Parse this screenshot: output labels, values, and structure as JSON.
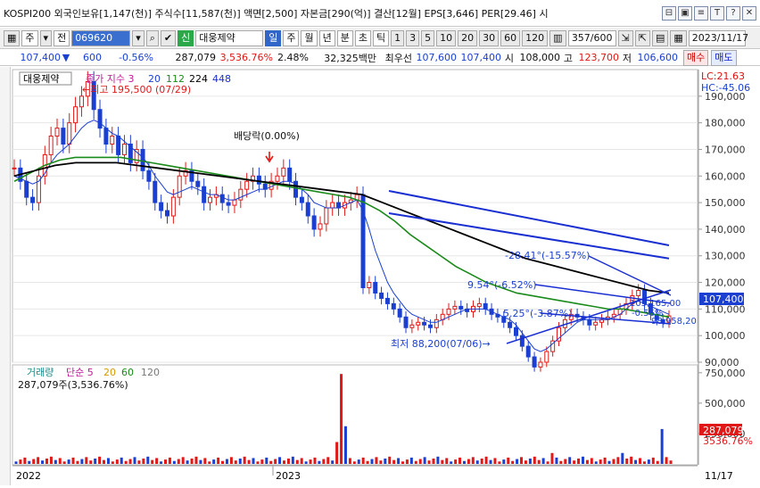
{
  "title": "KOSPI200 외국인보유[1,147(천)] 주식수[11,587(천)] 액면[2,500] 자본금[290(억)] 결산[12월] EPS[3,646] PER[29.46] 시",
  "window_buttons": [
    "⊟",
    "▣",
    "≡",
    "T",
    "?",
    "✕"
  ],
  "toolbar": {
    "type_label": "주",
    "prev_label": "전",
    "stock_code": "069620",
    "credit_label": "신",
    "stock_name": "대웅제약",
    "periods": [
      "일",
      "주",
      "월",
      "년",
      "분",
      "초",
      "틱"
    ],
    "intervals": [
      "1",
      "3",
      "5",
      "10",
      "20",
      "30",
      "60",
      "120"
    ],
    "page_count": "357/600",
    "date": "2023/11/17"
  },
  "price_bar": {
    "price": "107,400",
    "change": "600",
    "change_pct": "-0.56%",
    "volume": "287,079",
    "volume_ratio": "3,536.76%",
    "turnover": "2.48%",
    "amount": "32,325백만",
    "best_ask_label": "최우선",
    "best_ask": "107,600",
    "best_bid": "107,400",
    "open_label": "시",
    "open": "108,000",
    "high_label": "고",
    "high": "123,700",
    "low_label": "저",
    "low": "106,600",
    "buy_label": "매수",
    "sell_label": "매도"
  },
  "chart": {
    "stock_label": "대웅제약",
    "legend_prefix": "종가 지수 3",
    "ma_labels": [
      "20",
      "112",
      "224",
      "448"
    ],
    "lc_text": "LC:21.63",
    "hc_text": "HC:-45.06",
    "high_note": "←최고 195,500 (07/29)",
    "low_note": "최저 88,200(07/06)→",
    "dividend_note": "배당락(0.00%)",
    "angle_notes": [
      "-28.41°(-15.57%)",
      "9.54°(-6.52%)",
      "5.25°(-3.87%)",
      "105,165,00",
      "-0.56%",
      "98,958,20"
    ],
    "price_tag": "107,400",
    "volume_title": "거래량",
    "volume_ma_prefix": "단순 5",
    "volume_ma_labels": [
      "20",
      "60",
      "120"
    ],
    "volume_summary": "287,079주(3,536.76%)",
    "vol_tag": "287,079",
    "vol_pct_tag": "3536.76%",
    "x_labels": [
      "2022",
      "2023",
      "11/17"
    ]
  },
  "chart_data": {
    "type": "candlestick",
    "y_axis": {
      "min": 90000,
      "max": 200000,
      "ticks": [
        90000,
        100000,
        110000,
        120000,
        130000,
        140000,
        150000,
        160000,
        170000,
        180000,
        190000
      ]
    },
    "y_tick_labels": [
      "90,000",
      "100,000",
      "110,000",
      "120,000",
      "130,000",
      "140,000",
      "150,000",
      "160,000",
      "170,000",
      "180,000",
      "190,000"
    ],
    "close_path": [
      163000,
      158000,
      152000,
      150000,
      160000,
      168000,
      175000,
      178000,
      172000,
      180000,
      186000,
      190000,
      195500,
      185000,
      178000,
      172000,
      175000,
      168000,
      172000,
      165000,
      170000,
      162000,
      158000,
      150000,
      147000,
      145000,
      152000,
      160000,
      162000,
      158000,
      156000,
      150000,
      152000,
      153000,
      150000,
      149000,
      151000,
      155000,
      158000,
      160000,
      157000,
      155000,
      158000,
      160000,
      163000,
      158000,
      152000,
      150000,
      145000,
      140000,
      142000,
      148000,
      150000,
      148000,
      150000,
      151000,
      153000,
      118000,
      120000,
      116000,
      114000,
      112000,
      110000,
      107000,
      103000,
      104000,
      105000,
      104000,
      103000,
      106000,
      108000,
      110000,
      111000,
      110000,
      109000,
      111000,
      112000,
      110000,
      108000,
      107000,
      105000,
      103000,
      100000,
      96000,
      92000,
      88200,
      90000,
      94000,
      98000,
      103000,
      106000,
      108000,
      107000,
      106000,
      104000,
      105000,
      106000,
      107000,
      108000,
      110000,
      112000,
      115000,
      117000,
      112000,
      108000,
      106000,
      105000,
      107400
    ],
    "ma_20": [
      160000,
      159000,
      158000,
      157000,
      158000,
      161000,
      165000,
      168000,
      170000,
      172000,
      175000,
      178000,
      180000,
      181000,
      180000,
      178000,
      176000,
      175000,
      173000,
      171000,
      169000,
      167000,
      164000,
      160000,
      157000,
      154000,
      153000,
      154000,
      155000,
      156000,
      155000,
      154000,
      153000,
      153000,
      152000,
      151000,
      151000,
      152000,
      153000,
      154000,
      155000,
      155000,
      156000,
      157000,
      158000,
      158000,
      157000,
      155000,
      153000,
      150000,
      149000,
      148000,
      148000,
      148000,
      149000,
      150000,
      151000,
      147000,
      140000,
      132000,
      126000,
      120000,
      116000,
      113000,
      110000,
      108000,
      107000,
      106000,
      105000,
      105000,
      106000,
      107000,
      108000,
      109000,
      110000,
      110000,
      110000,
      110000,
      109000,
      108000,
      107000,
      106000,
      104000,
      101000,
      98000,
      95000,
      94000,
      95000,
      97000,
      99000,
      101000,
      103000,
      105000,
      106000,
      106000,
      106000,
      106000,
      106000,
      107000,
      108000,
      110000,
      112000,
      113000,
      112000,
      111000,
      110000,
      109000,
      108000
    ],
    "ma_112": [
      158000,
      161000,
      164000,
      166000,
      167000,
      167000,
      167000,
      167000,
      166000,
      165000,
      164000,
      163000,
      162000,
      161000,
      160000,
      159000,
      158000,
      157000,
      156000,
      155000,
      154000,
      153000,
      152000,
      150000,
      147000,
      143000,
      138000,
      134000,
      130000,
      126000,
      123000,
      120000,
      118000,
      116000,
      115000,
      114000,
      113000,
      112000,
      111000,
      110000,
      110000,
      109000,
      108000,
      107000
    ],
    "ma_224": [
      160000,
      162000,
      164000,
      165000,
      165000,
      165000,
      164000,
      163000,
      162000,
      161000,
      160000,
      159000,
      158000,
      157000,
      156000,
      155000,
      154000,
      153000,
      150000,
      147000,
      144000,
      141000,
      138000,
      135000,
      132000,
      129000,
      127000,
      125000,
      123000,
      121000,
      119000,
      117000,
      116000
    ],
    "ma_448": [
      146000,
      129000
    ],
    "volume_scale_max": 800000,
    "volume_ticks": [
      "750,000",
      "500,000",
      "250,000"
    ]
  }
}
